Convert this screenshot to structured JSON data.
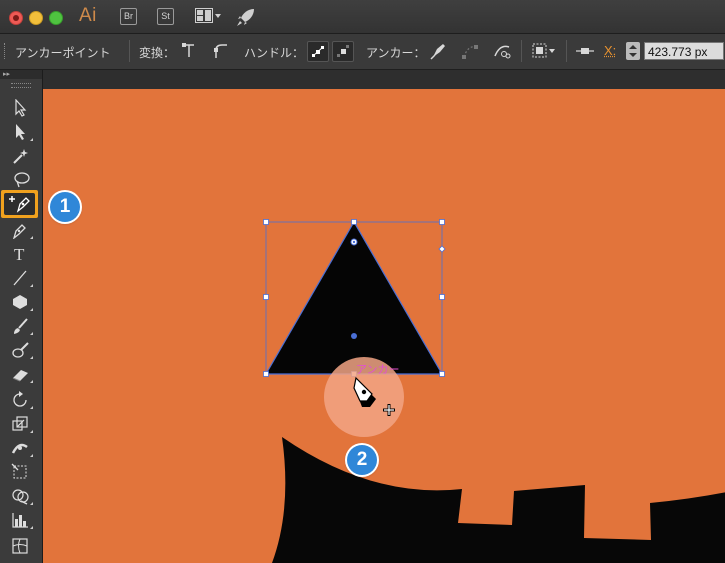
{
  "app": {
    "logo": "Ai",
    "bridge_label": "Br",
    "stock_label": "St",
    "icons": [
      "window-close-icon",
      "window-minimize-icon",
      "window-maximize-icon",
      "workspace-layout-icon",
      "gpu-rocket-icon"
    ]
  },
  "control_bar": {
    "tool_name": "アンカーポイント",
    "convert_label": "変換：",
    "handle_label": "ハンドル：",
    "anchor_label": "アンカー：",
    "x_label": "X:",
    "x_value": "423.773 px"
  },
  "canvas": {
    "anchor_tooltip": "アンカー",
    "background_color": "#e2743b",
    "selection_color": "#4a6fd6"
  },
  "callouts": {
    "first": "1",
    "second": "2"
  },
  "tools": [
    "selection-tool",
    "direct-selection-tool",
    "magic-wand-tool",
    "lasso-tool",
    "add-anchor-point-tool",
    "pen-tool",
    "type-tool",
    "line-segment-tool",
    "polygon-tool",
    "paintbrush-tool",
    "blob-brush-tool",
    "eraser-tool",
    "rotate-tool",
    "scale-tool",
    "width-tool",
    "free-transform-tool",
    "shape-builder-tool",
    "graph-tool",
    "mesh-tool"
  ]
}
